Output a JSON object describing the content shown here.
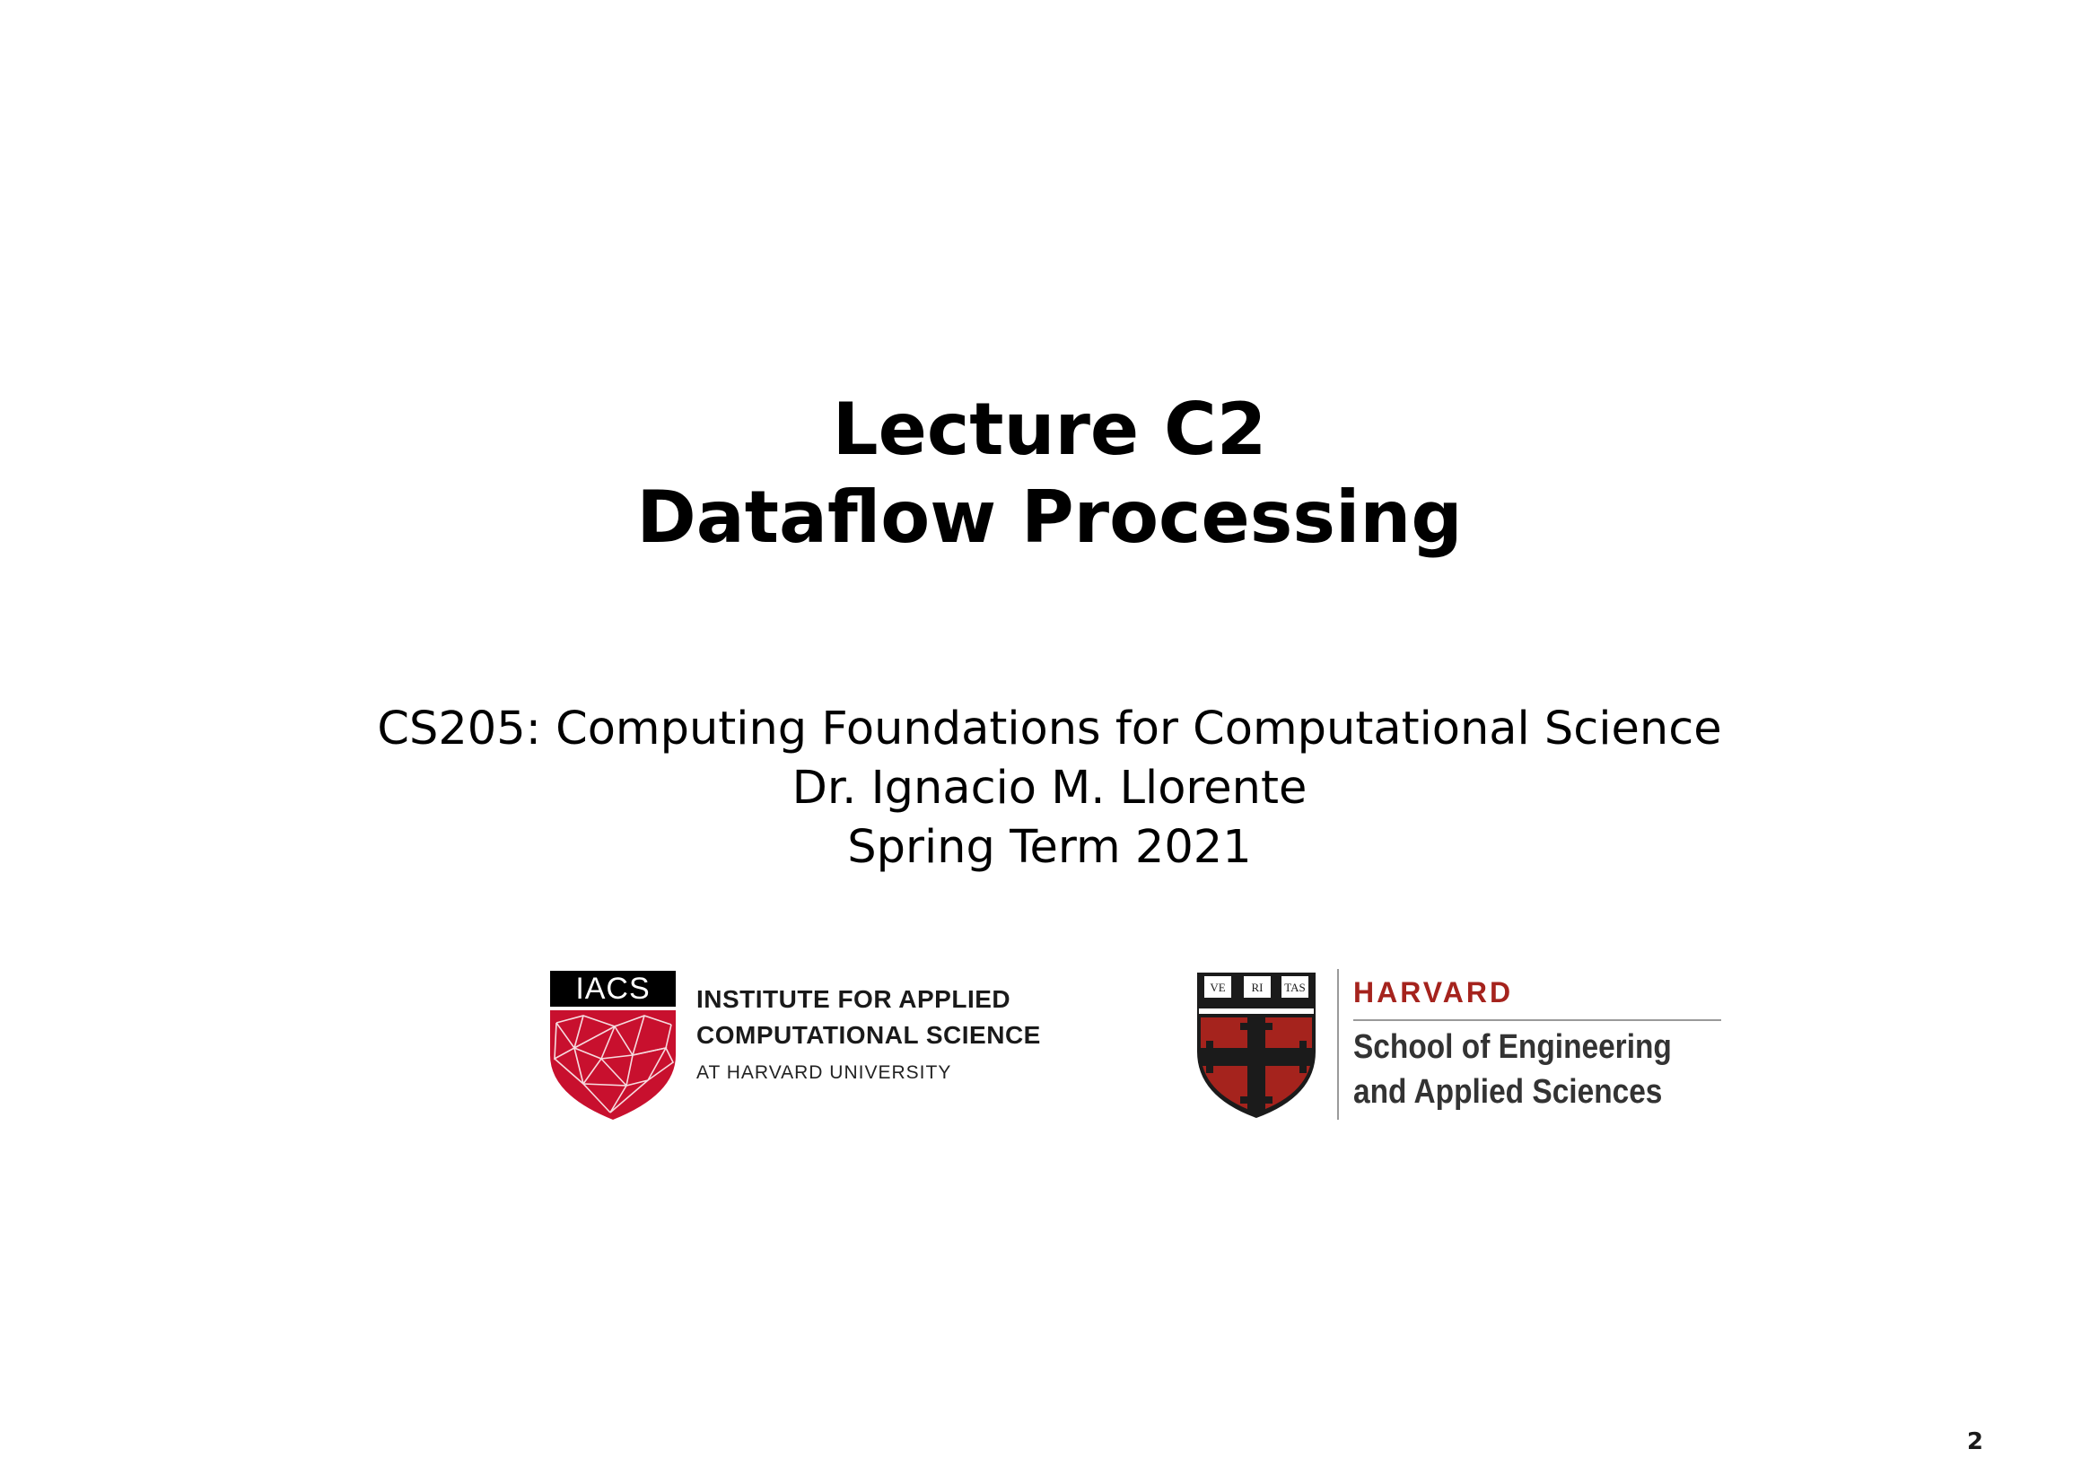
{
  "title": {
    "line1": "Lecture C2",
    "line2": "Dataflow Processing"
  },
  "subtitle": {
    "course": "CS205: Computing Foundations for Computational Science",
    "instructor": "Dr. Ignacio M. Llorente",
    "term": "Spring Term 2021"
  },
  "logos": {
    "iacs": {
      "badge": "IACS",
      "line1": "INSTITUTE FOR APPLIED",
      "line2": "COMPUTATIONAL SCIENCE",
      "line3": "AT HARVARD UNIVERSITY",
      "accent_color": "#c8102e"
    },
    "seas": {
      "heading": "HARVARD",
      "line1": "School of Engineering",
      "line2": "and Applied Sciences",
      "shield_text": [
        "VE",
        "RI",
        "TAS"
      ],
      "accent_color": "#a5231d"
    }
  },
  "page_number": "2"
}
